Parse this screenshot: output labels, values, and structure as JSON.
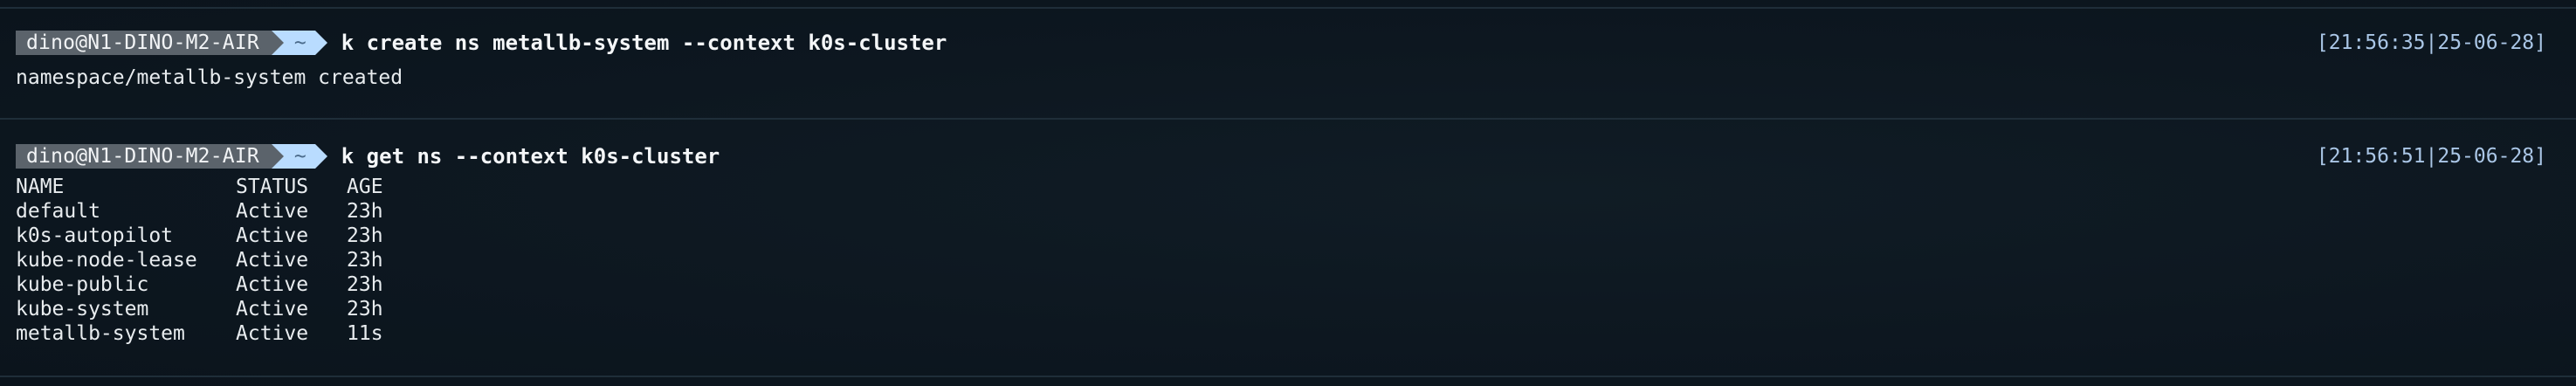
{
  "blocks": [
    {
      "prompt": {
        "user_host": "dino@N1-DINO-M2-AIR",
        "dir": "~"
      },
      "command": "k create ns metallb-system --context k0s-cluster",
      "timestamp": "[21:56:35|25-06-28]",
      "output": "namespace/metallb-system created"
    },
    {
      "prompt": {
        "user_host": "dino@N1-DINO-M2-AIR",
        "dir": "~"
      },
      "command": "k get ns --context k0s-cluster",
      "timestamp": "[21:56:51|25-06-28]",
      "table": {
        "headers": [
          "NAME",
          "STATUS",
          "AGE"
        ],
        "rows": [
          [
            "default",
            "Active",
            "23h"
          ],
          [
            "k0s-autopilot",
            "Active",
            "23h"
          ],
          [
            "kube-node-lease",
            "Active",
            "23h"
          ],
          [
            "kube-public",
            "Active",
            "23h"
          ],
          [
            "kube-system",
            "Active",
            "23h"
          ],
          [
            "metallb-system",
            "Active",
            "11s"
          ]
        ]
      }
    }
  ],
  "colors": {
    "background": "#0e1820",
    "prompt_user_bg": "#5b636b",
    "prompt_dir_bg": "#b9dcff",
    "timestamp": "#aac6e6",
    "text": "#e8ecef"
  }
}
